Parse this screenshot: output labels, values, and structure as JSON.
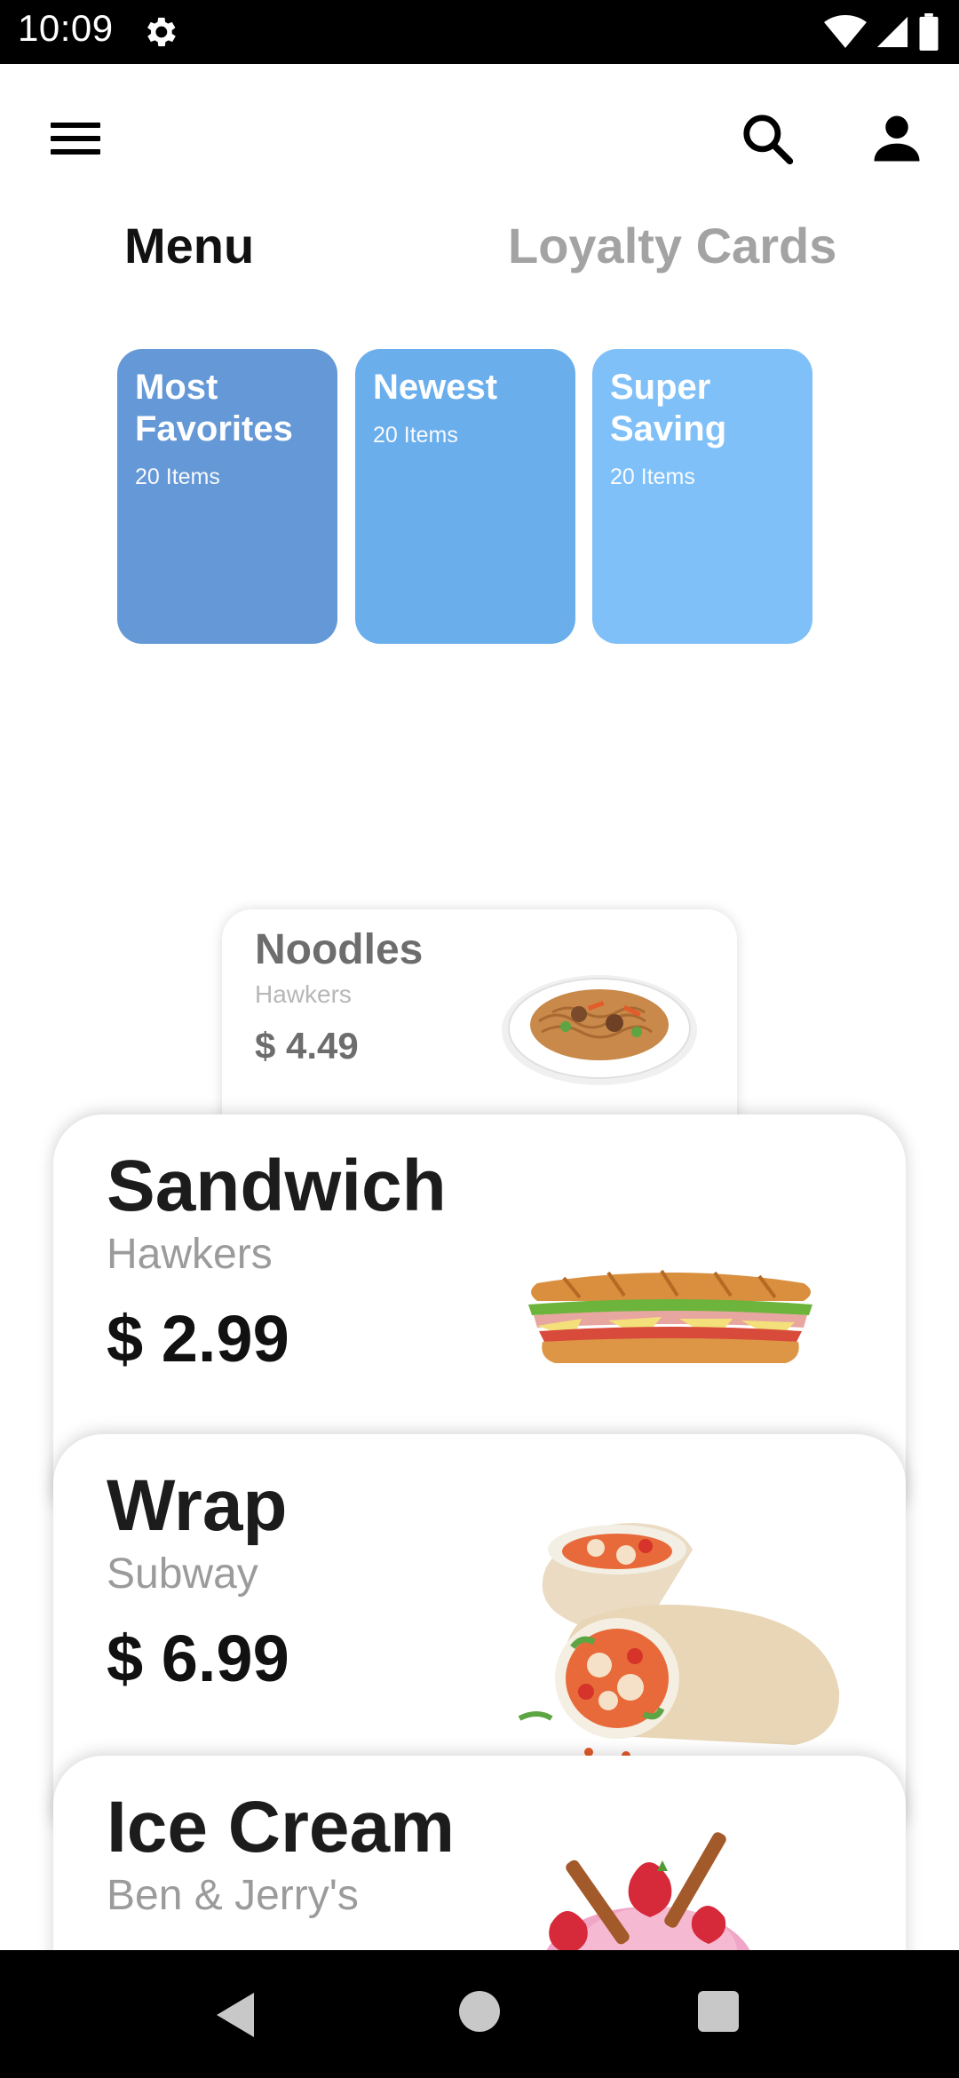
{
  "status_bar": {
    "time": "10:09",
    "icons": [
      "settings-gear-icon",
      "wifi-icon",
      "cell-signal-icon",
      "battery-icon"
    ]
  },
  "app_bar": {
    "icons": [
      "hamburger-menu-icon",
      "search-icon",
      "account-icon"
    ]
  },
  "tabs": [
    {
      "label": "Menu",
      "active": true
    },
    {
      "label": "Loyalty Cards",
      "active": false
    }
  ],
  "categories": [
    {
      "title": "Most Favorites",
      "count": "20 Items",
      "color": "#6498D6"
    },
    {
      "title": "Newest",
      "count": "20 Items",
      "color": "#6AAEEC"
    },
    {
      "title": "Super Saving",
      "count": "20 Items",
      "color": "#7FC0F8"
    }
  ],
  "foods": [
    {
      "name": "Noodles",
      "vendor": "Hawkers",
      "price": "$ 4.49",
      "image": "noodles-plate"
    },
    {
      "name": "Sandwich",
      "vendor": "Hawkers",
      "price": "$ 2.99",
      "image": "sandwich-sub"
    },
    {
      "name": "Wrap",
      "vendor": "Subway",
      "price": "$ 6.99",
      "image": "chicken-wrap"
    },
    {
      "name": "Ice Cream",
      "vendor": "Ben & Jerry's",
      "price": "",
      "image": "ice-cream-scoops"
    }
  ],
  "nav_bar": {
    "icons": [
      "back-triangle-icon",
      "home-circle-icon",
      "recents-square-icon"
    ]
  }
}
